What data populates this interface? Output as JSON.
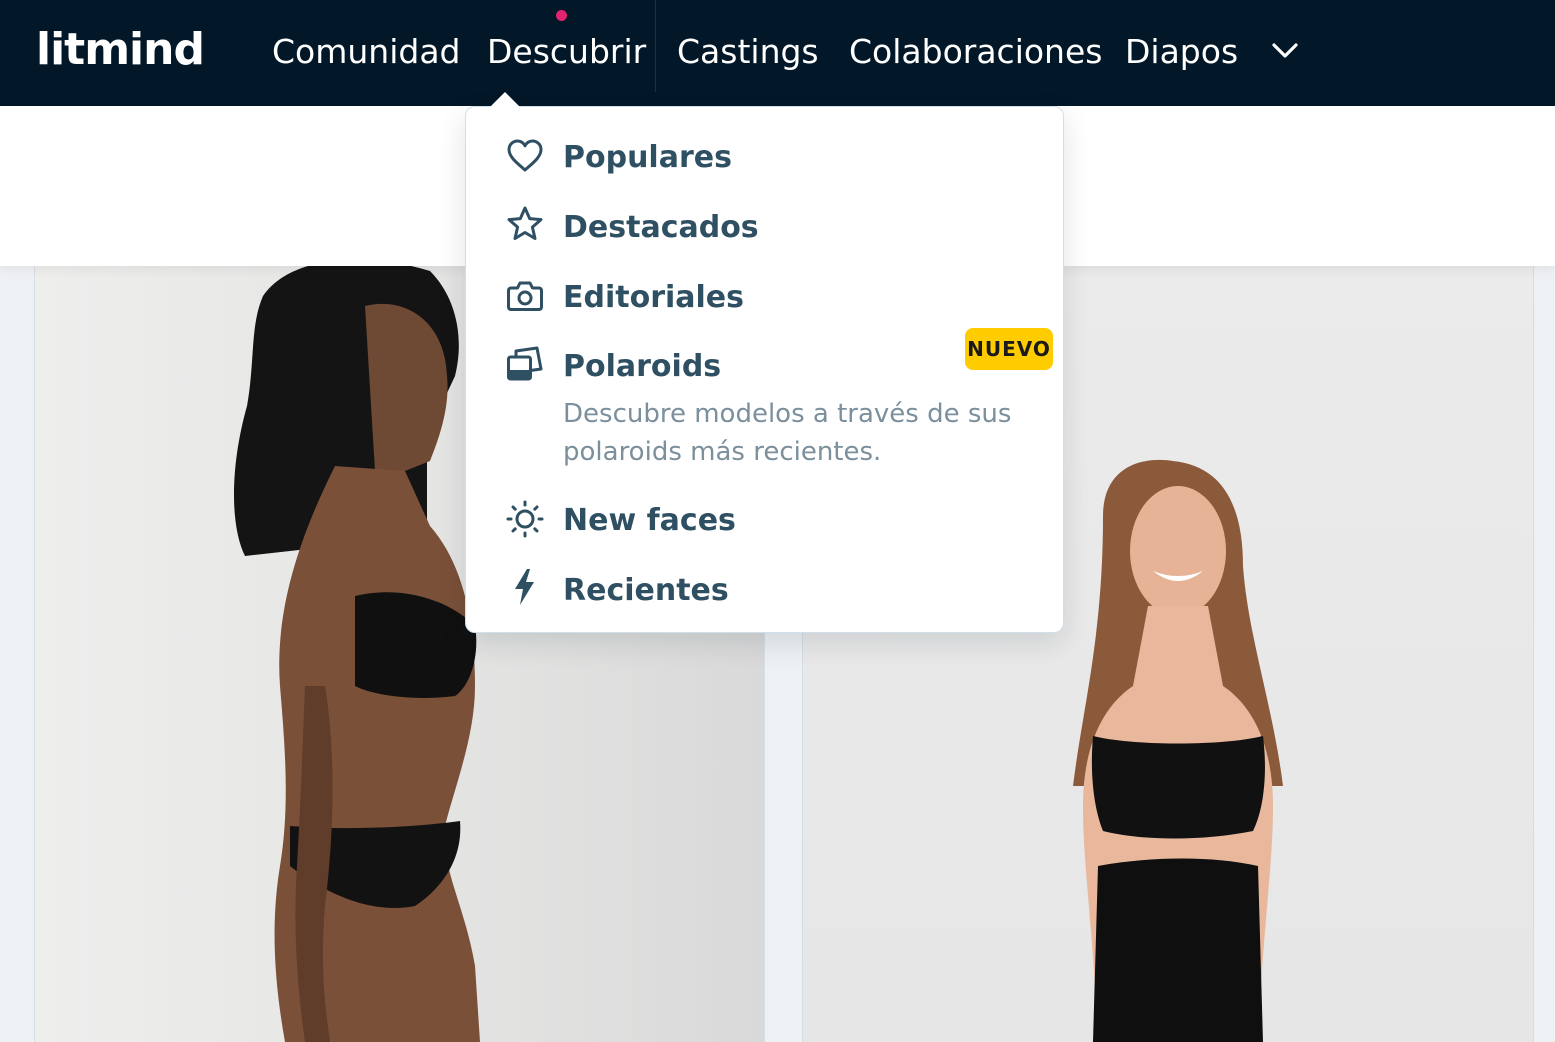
{
  "header": {
    "logo": "litmind",
    "nav": [
      {
        "label": "Comunidad"
      },
      {
        "label": "Descubrir",
        "active": true
      },
      {
        "label": "Castings"
      },
      {
        "label": "Colaboraciones"
      },
      {
        "label": "Diapos"
      }
    ],
    "more_icon": "chevron-down-icon",
    "active_dot_color": "#e0246f"
  },
  "discover_menu": {
    "items": [
      {
        "label": "Populares",
        "icon": "heart-icon"
      },
      {
        "label": "Destacados",
        "icon": "star-icon"
      },
      {
        "label": "Editoriales",
        "icon": "camera-icon"
      },
      {
        "label": "Polaroids",
        "icon": "polaroid-icon",
        "badge": "NUEVO",
        "description": "Descubre modelos a través de sus polaroids más recientes."
      },
      {
        "label": "New faces",
        "icon": "sun-icon"
      },
      {
        "label": "Recientes",
        "icon": "lightning-icon"
      }
    ]
  },
  "colors": {
    "header_bg": "#021727",
    "menu_text": "#2f4f63",
    "badge_bg": "#ffcc00"
  }
}
